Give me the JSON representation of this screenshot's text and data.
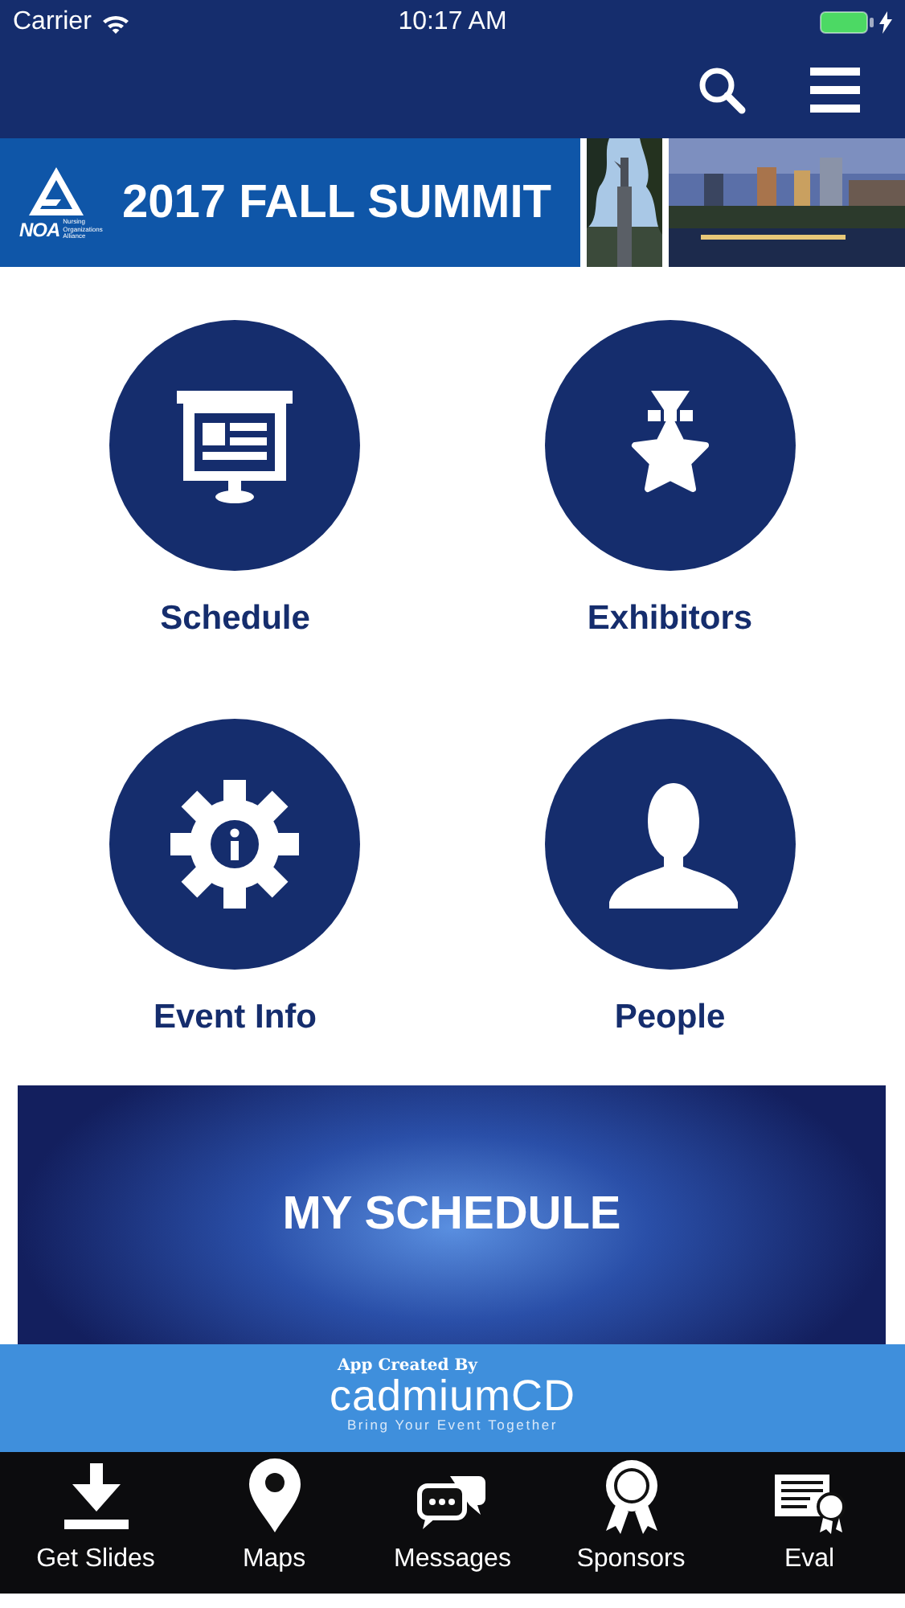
{
  "status_bar": {
    "carrier": "Carrier",
    "time": "10:17 AM"
  },
  "banner": {
    "logo_text": "NOA",
    "logo_subtext": "Nursing Organizations Alliance",
    "title": "2017 FALL SUMMIT"
  },
  "tiles": [
    {
      "label": "Schedule",
      "kind": "projector"
    },
    {
      "label": "Exhibitors",
      "kind": "medal"
    },
    {
      "label": "Event Info",
      "kind": "gear"
    },
    {
      "label": "People",
      "kind": "person"
    }
  ],
  "promo": {
    "title": "MY SCHEDULE"
  },
  "credit": {
    "caption": "App Created By",
    "brand": "cadmiumCD",
    "tagline": "Bring Your Event Together"
  },
  "tab_bar": [
    {
      "label": "Get Slides",
      "kind": "download"
    },
    {
      "label": "Maps",
      "kind": "pin"
    },
    {
      "label": "Messages",
      "kind": "chat"
    },
    {
      "label": "Sponsors",
      "kind": "ribbon"
    },
    {
      "label": "Eval",
      "kind": "certificate"
    }
  ]
}
